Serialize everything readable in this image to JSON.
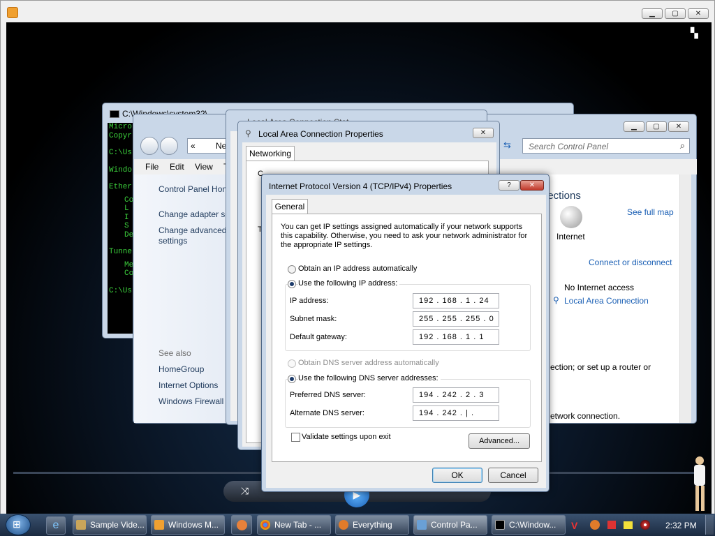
{
  "media_player": {
    "controls": {
      "switch_icon": "switch-to-library-icon",
      "shuffle_icon": "shuffle-icon",
      "play_icon": "play-icon"
    }
  },
  "cmd": {
    "title": "C:\\Windows\\system32\\",
    "lines": [
      "Micro",
      "Copyr",
      "C:\\Us",
      "Windo",
      "Ether",
      "Co",
      "L",
      "I",
      "S",
      "De",
      "Tunne",
      "Me",
      "Co",
      "C:\\Us"
    ]
  },
  "control_panel": {
    "address": "Ne",
    "search_placeholder": "Search Control Panel",
    "menu": [
      "File",
      "Edit",
      "View",
      "T"
    ],
    "sidebar": {
      "home": "Control Panel Hon",
      "adapter": "Change adapter se",
      "advanced_line1": "Change advanced",
      "advanced_line2": "settings",
      "see_also": "See also",
      "items": [
        "HomeGroup",
        "Internet Options",
        "Windows Firewall"
      ]
    },
    "main": {
      "heading": "nections",
      "see_full_map": "See full map",
      "internet": "Internet",
      "connect": "Connect or disconnect",
      "no_internet": "No Internet access",
      "lan": "Local Area Connection",
      "setup": "ection; or set up a router or",
      "network_conn": "etwork connection."
    }
  },
  "lac_status": {
    "title": "Local Area Connection Stat"
  },
  "lac_props": {
    "title": "Local Area Connection Properties",
    "tab": "Networking",
    "frag1": "C",
    "frag2": "T"
  },
  "ipv4": {
    "title": "Internet Protocol Version 4 (TCP/IPv4) Properties",
    "help": "?",
    "tab": "General",
    "desc": "You can get IP settings assigned automatically if your network supports this capability. Otherwise, you need to ask your network administrator for the appropriate IP settings.",
    "obtain_ip": "Obtain an IP address automatically",
    "use_ip": "Use the following IP address:",
    "ip_label": "IP address:",
    "ip_value": "192 . 168 .  1  .  24",
    "mask_label": "Subnet mask:",
    "mask_value": "255 . 255 . 255 .  0",
    "gw_label": "Default gateway:",
    "gw_value": "192 . 168 .  1  .  1",
    "obtain_dns": "Obtain DNS server address automatically",
    "use_dns": "Use the following DNS server addresses:",
    "pref_label": "Preferred DNS server:",
    "pref_value": "194 . 242 .  2  .  3",
    "alt_label": "Alternate DNS server:",
    "alt_value": "194 . 242 .  |  .",
    "validate": "Validate settings upon exit",
    "advanced": "Advanced...",
    "ok": "OK",
    "cancel": "Cancel"
  },
  "taskbar": {
    "items": [
      "Sample Vide...",
      "Windows M...",
      "New Tab - ...",
      "Everything",
      "Control Pa...",
      "C:\\Window..."
    ],
    "clock": "2:32 PM"
  }
}
